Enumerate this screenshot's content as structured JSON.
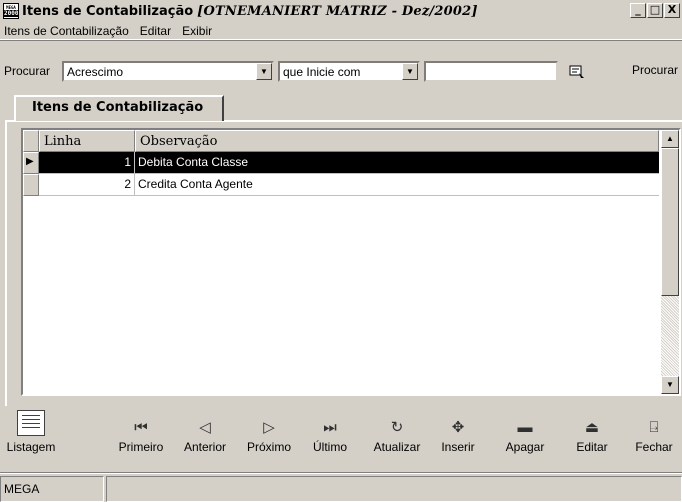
{
  "window": {
    "title": "Itens de Contabilização",
    "subtitle": "[OTNEMANIERT MATRIZ - Dez/2002]",
    "app_icon_text": [
      "MEGA",
      "2000"
    ],
    "minimize": "_",
    "maximize": "□",
    "close": "X"
  },
  "menu": [
    "Itens de Contabilização",
    "Editar",
    "Exibir"
  ],
  "search": {
    "label": "Procurar",
    "field_value": "Acrescimo",
    "mode_value": "que Inicie com",
    "text_value": "",
    "button_label": "Procurar"
  },
  "tab": {
    "label": "Itens de Contabilização"
  },
  "grid": {
    "columns": [
      "Linha",
      "Observação"
    ],
    "rows": [
      {
        "linha": "1",
        "observacao": "Debita Conta Classe",
        "selected": true
      },
      {
        "linha": "2",
        "observacao": "Credita Conta Agente",
        "selected": false
      }
    ]
  },
  "toolbar": {
    "listagem": "Listagem",
    "primeiro": "Primeiro",
    "anterior": "Anterior",
    "proximo": "Próximo",
    "ultimo": "Último",
    "atualizar": "Atualizar",
    "inserir": "Inserir",
    "apagar": "Apagar",
    "editar": "Editar",
    "fechar": "Fechar"
  },
  "icons": {
    "primeiro": "first-record-icon",
    "anterior": "previous-icon",
    "proximo": "next-icon",
    "ultimo": "last-record-icon",
    "atualizar": "refresh-icon",
    "inserir": "insert-icon",
    "apagar": "delete-icon",
    "editar": "edit-icon",
    "fechar": "exit-door-icon"
  },
  "status": {
    "panel1": "MEGA",
    "panel2": ""
  },
  "colors": {
    "selected_row_bg": "#000000",
    "window_bg": "#d4d0c8"
  }
}
